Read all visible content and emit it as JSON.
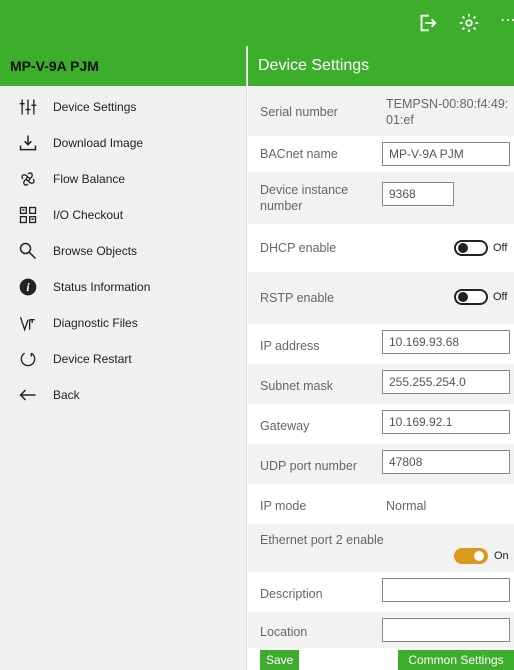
{
  "header": {
    "device_name": "MP-V-9A PJM",
    "page_title": "Device Settings"
  },
  "sidebar": {
    "items": [
      {
        "label": "Device Settings",
        "icon": "sliders-icon"
      },
      {
        "label": "Download Image",
        "icon": "download-icon"
      },
      {
        "label": "Flow Balance",
        "icon": "fan-icon"
      },
      {
        "label": "I/O Checkout",
        "icon": "grid-checkout-icon"
      },
      {
        "label": "Browse Objects",
        "icon": "search-icon"
      },
      {
        "label": "Status Information",
        "icon": "info-icon"
      },
      {
        "label": "Diagnostic Files",
        "icon": "diagnostic-icon"
      },
      {
        "label": "Device Restart",
        "icon": "restart-icon"
      },
      {
        "label": "Back",
        "icon": "back-arrow-icon"
      }
    ]
  },
  "settings": {
    "serial_label": "Serial number",
    "serial_value": "TEMPSN-00:80:f4:49:\n01:ef",
    "bacnet_label": "BACnet name",
    "bacnet_value": "MP-V-9A PJM",
    "instance_label": "Device instance\nnumber",
    "instance_value": "9368",
    "dhcp_label": "DHCP enable",
    "dhcp_state": "Off",
    "rstp_label": "RSTP enable",
    "rstp_state": "Off",
    "ip_label": "IP address",
    "ip_value": "10.169.93.68",
    "subnet_label": "Subnet mask",
    "subnet_value": "255.255.254.0",
    "gateway_label": "Gateway",
    "gateway_value": "10.169.92.1",
    "udp_label": "UDP port number",
    "udp_value": "47808",
    "ipmode_label": "IP mode",
    "ipmode_value": "Normal",
    "eth2_label": "Ethernet port 2 enable",
    "eth2_state": "On",
    "description_label": "Description",
    "description_value": "",
    "location_label": "Location",
    "location_value": ""
  },
  "footer": {
    "save_label": "Save",
    "common_label": "Common Settings"
  },
  "colors": {
    "brand_green": "#3dae2b",
    "toggle_on": "#d99a1d"
  },
  "toolbar_icons": [
    "logout-icon",
    "settings-gear-icon",
    "more-icon"
  ]
}
